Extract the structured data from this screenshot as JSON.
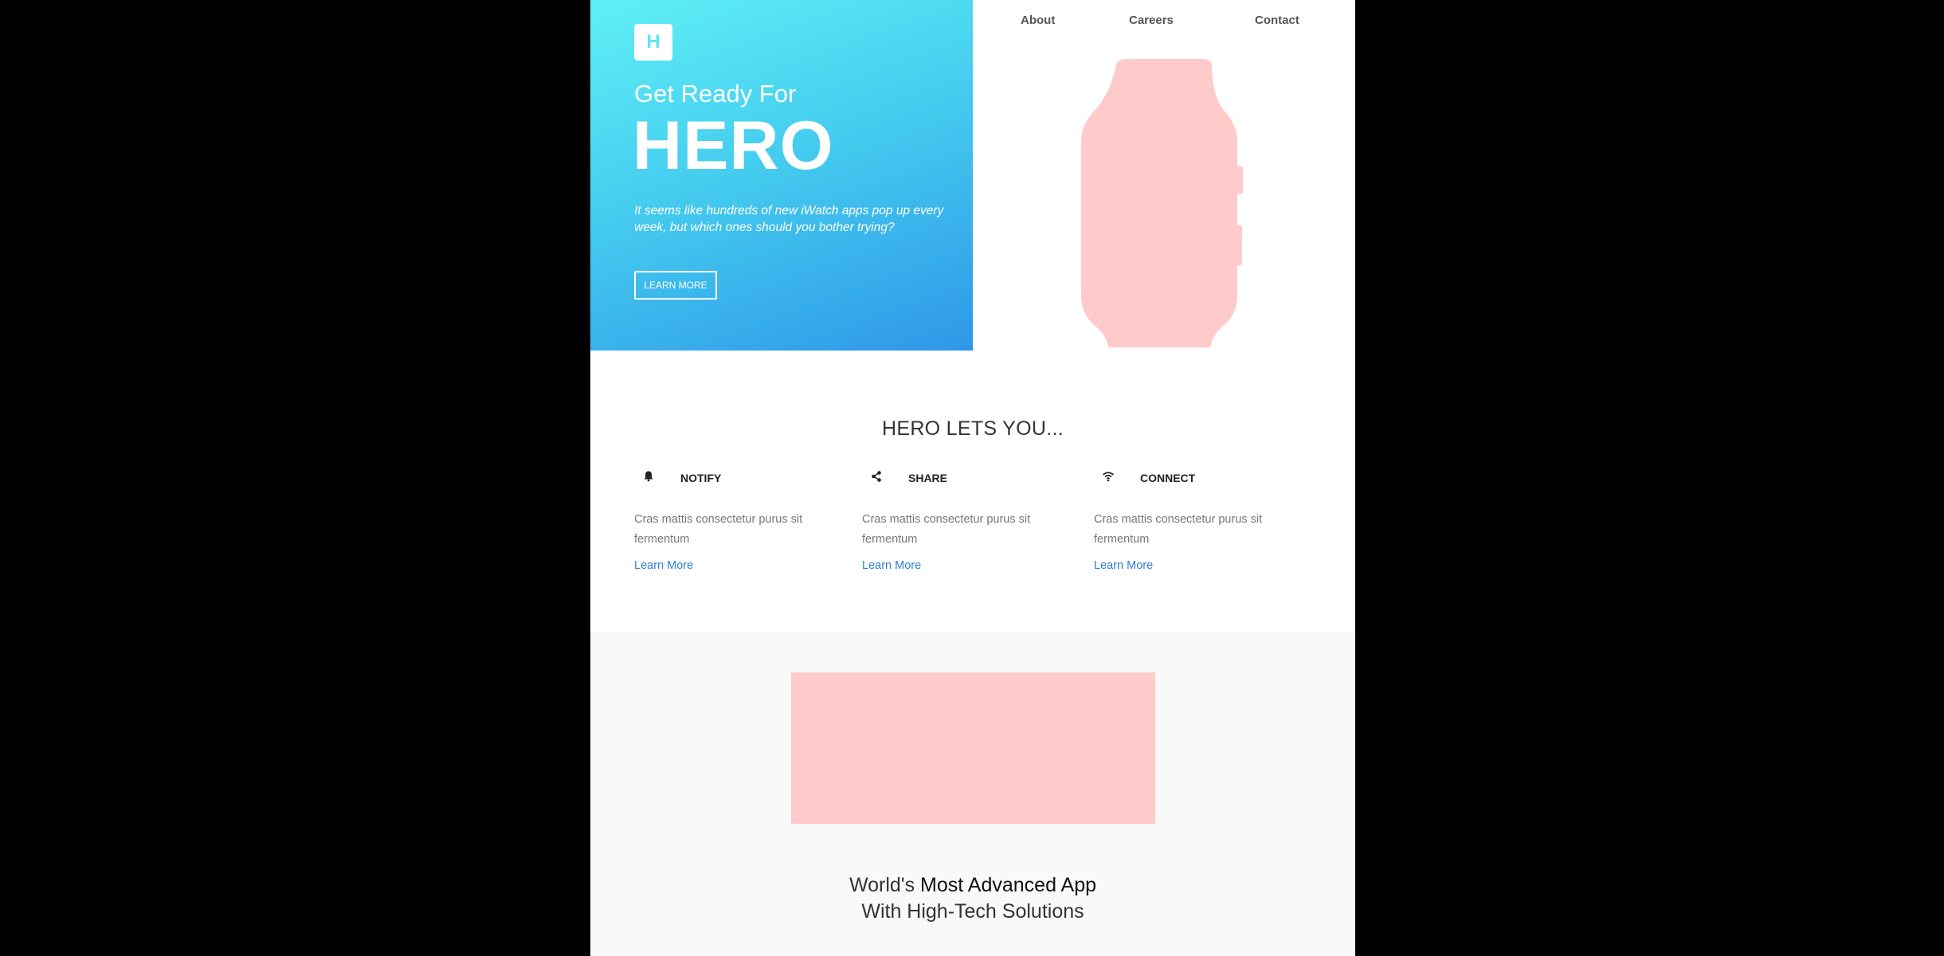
{
  "nav": {
    "items": [
      {
        "label": "About"
      },
      {
        "label": "Careers"
      },
      {
        "label": "Contact"
      }
    ]
  },
  "hero": {
    "logo_letter": "H",
    "subtitle": "Get Ready For",
    "title": "HERO",
    "description": "It seems like hundreds of new iWatch apps pop up every week, but which ones should you bother trying?",
    "button_label": "LEARN MORE",
    "gradient_colors": [
      "#5ff0f6",
      "#2e97e8"
    ],
    "image_placeholder_color": "#ffcaca"
  },
  "features": {
    "title": "HERO LETS YOU...",
    "items": [
      {
        "icon": "bell-icon",
        "name": "NOTIFY",
        "description": "Cras mattis consectetur purus sit fermentum",
        "link": "Learn More"
      },
      {
        "icon": "share-icon",
        "name": "SHARE",
        "description": "Cras mattis consectetur purus sit fermentum",
        "link": "Learn More"
      },
      {
        "icon": "wifi-icon",
        "name": "CONNECT",
        "description": "Cras mattis consectetur purus sit fermentum",
        "link": "Learn More"
      }
    ],
    "link_color": "#2f7fd3"
  },
  "showcase": {
    "placeholder_color": "#ffcaca",
    "tagline_prefix": "World's ",
    "tagline_bold": "Most Advanced App",
    "tagline_line2": "With High-Tech Solutions"
  }
}
